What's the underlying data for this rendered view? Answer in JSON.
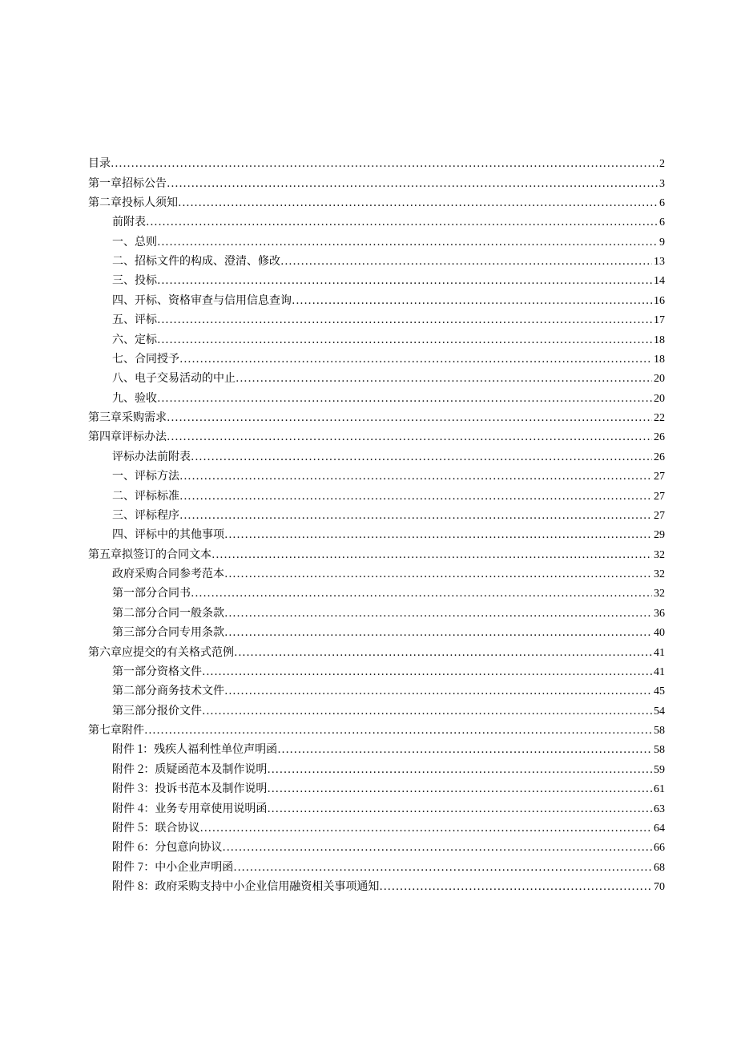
{
  "toc": [
    {
      "level": 0,
      "label": "目录",
      "page": "2"
    },
    {
      "level": 0,
      "label": "第一章招标公告",
      "page": "3"
    },
    {
      "level": 0,
      "label": "第二章投标人须知",
      "page": "6"
    },
    {
      "level": 1,
      "label": "前附表",
      "page": "6"
    },
    {
      "level": 1,
      "label": "一、总则",
      "page": "9"
    },
    {
      "level": 1,
      "label": "二、招标文件的构成、澄清、修改",
      "page": "13"
    },
    {
      "level": 1,
      "label": "三、投标",
      "page": "14"
    },
    {
      "level": 1,
      "label": "四、开标、资格审查与信用信息查询",
      "page": "16"
    },
    {
      "level": 1,
      "label": "五、评标",
      "page": "17"
    },
    {
      "level": 1,
      "label": "六、定标",
      "page": "18"
    },
    {
      "level": 1,
      "label": "七、合同授予",
      "page": "18"
    },
    {
      "level": 1,
      "label": "八、电子交易活动的中止",
      "page": "20"
    },
    {
      "level": 1,
      "label": "九、验收",
      "page": "20"
    },
    {
      "level": 0,
      "label": "第三章采购需求",
      "page": "22"
    },
    {
      "level": 0,
      "label": "第四章评标办法",
      "page": "26"
    },
    {
      "level": 1,
      "label": "评标办法前附表",
      "page": "26"
    },
    {
      "level": 1,
      "label": "一、评标方法",
      "page": "27"
    },
    {
      "level": 1,
      "label": "二、评标标准",
      "page": "27"
    },
    {
      "level": 1,
      "label": "三、评标程序",
      "page": "27"
    },
    {
      "level": 1,
      "label": "四、评标中的其他事项",
      "page": "29"
    },
    {
      "level": 0,
      "label": "第五章拟签订的合同文本",
      "page": "32"
    },
    {
      "level": 1,
      "label": "政府采购合同参考范本",
      "page": "32"
    },
    {
      "level": 1,
      "label": "第一部分合同书",
      "page": "32"
    },
    {
      "level": 1,
      "label": "第二部分合同一般条款",
      "page": "36"
    },
    {
      "level": 1,
      "label": "第三部分合同专用条款",
      "page": "40"
    },
    {
      "level": 0,
      "label": "第六章应提交的有关格式范例",
      "page": "41"
    },
    {
      "level": 1,
      "label": "第一部分资格文件",
      "page": "41"
    },
    {
      "level": 1,
      "label": "第二部分商务技术文件",
      "page": "45"
    },
    {
      "level": 1,
      "label": "第三部分报价文件",
      "page": "54"
    },
    {
      "level": 0,
      "label": "第七章附件",
      "page": "58"
    },
    {
      "level": 1,
      "label": "附件 1：残疾人福利性单位声明函 ",
      "page": "58"
    },
    {
      "level": 1,
      "label": "附件 2：质疑函范本及制作说明 ",
      "page": "59"
    },
    {
      "level": 1,
      "label": "附件 3：投诉书范本及制作说明 ",
      "page": "61"
    },
    {
      "level": 1,
      "label": "附件 4：业务专用章使用说明函 ",
      "page": "63"
    },
    {
      "level": 1,
      "label": "附件 5：联合协议 ",
      "page": "64"
    },
    {
      "level": 1,
      "label": "附件 6：分包意向协议 ",
      "page": "66"
    },
    {
      "level": 1,
      "label": "附件 7：中小企业声明函 ",
      "page": "68"
    },
    {
      "level": 1,
      "label": "附件 8：政府采购支持中小企业信用融资相关事项通知 ",
      "page": "70"
    }
  ]
}
